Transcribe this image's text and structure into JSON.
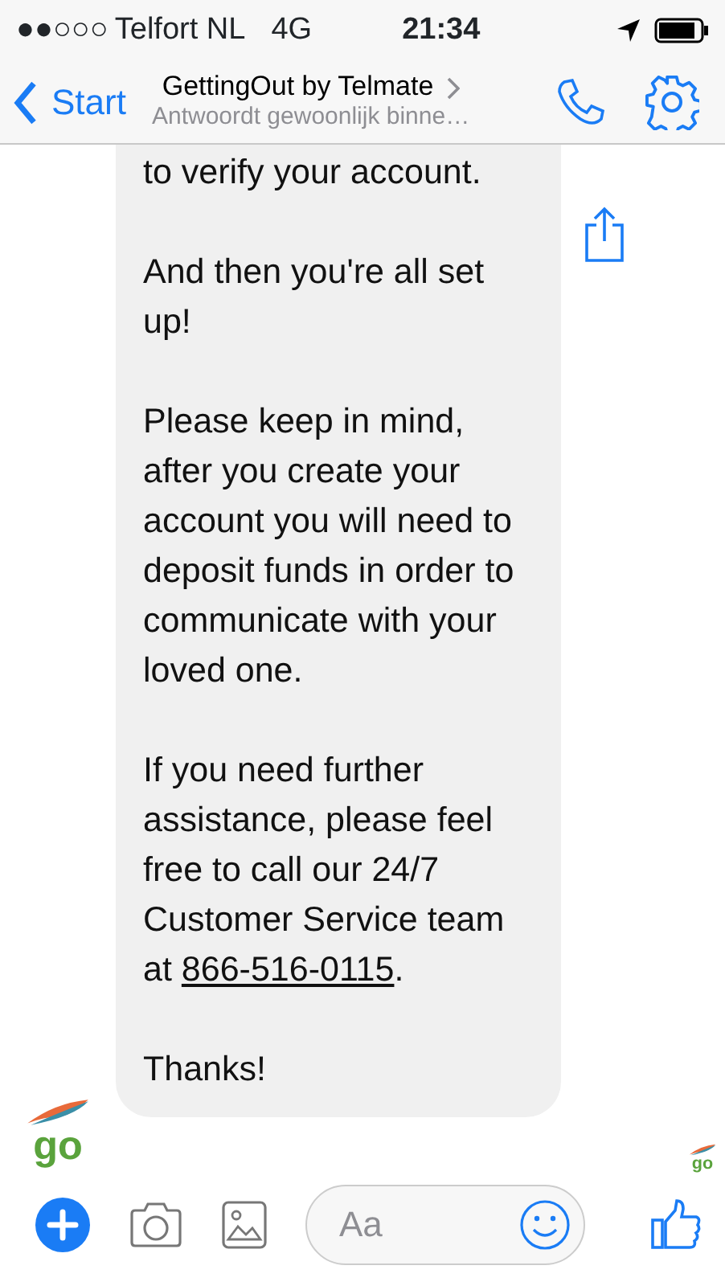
{
  "status_bar": {
    "signal_bars": "●●○○○",
    "carrier": "Telfort NL",
    "network": "4G",
    "time": "21:34"
  },
  "header": {
    "back_label": "Start",
    "title": "GettingOut by Telmate",
    "subtitle": "Antwoordt gewoonlijk binne…"
  },
  "message": {
    "sender_logo": "go",
    "paragraphs": [
      {
        "text": "to verify your account."
      },
      {
        "text": "And then you're all set up!"
      },
      {
        "text": "Please keep in mind, after you create your account you will need to deposit funds in order to communicate with your loved one."
      },
      {
        "text": "If you need further assistance, please feel free to call our 24/7 Customer Service team at",
        "link": "866-516-0115",
        "after": "."
      },
      {
        "text": "Thanks!"
      }
    ],
    "seen_logo": "go"
  },
  "composer": {
    "placeholder": "Aa"
  }
}
